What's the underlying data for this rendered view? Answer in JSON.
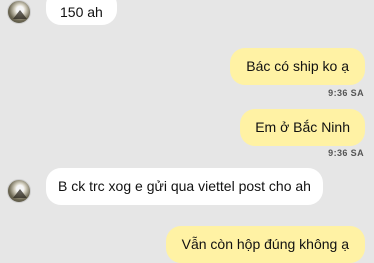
{
  "messages": [
    {
      "direction": "in",
      "text": "150 ah"
    },
    {
      "direction": "out",
      "text": "Bác có ship ko ạ",
      "time": "9:36 SA"
    },
    {
      "direction": "out",
      "text": "Em ở Bắc Ninh",
      "time": "9:36 SA"
    },
    {
      "direction": "in",
      "text": "B ck trc xog e gửi qua viettel post cho ah"
    },
    {
      "direction": "out",
      "text": "Vẫn còn hộp đúng không ạ"
    }
  ]
}
